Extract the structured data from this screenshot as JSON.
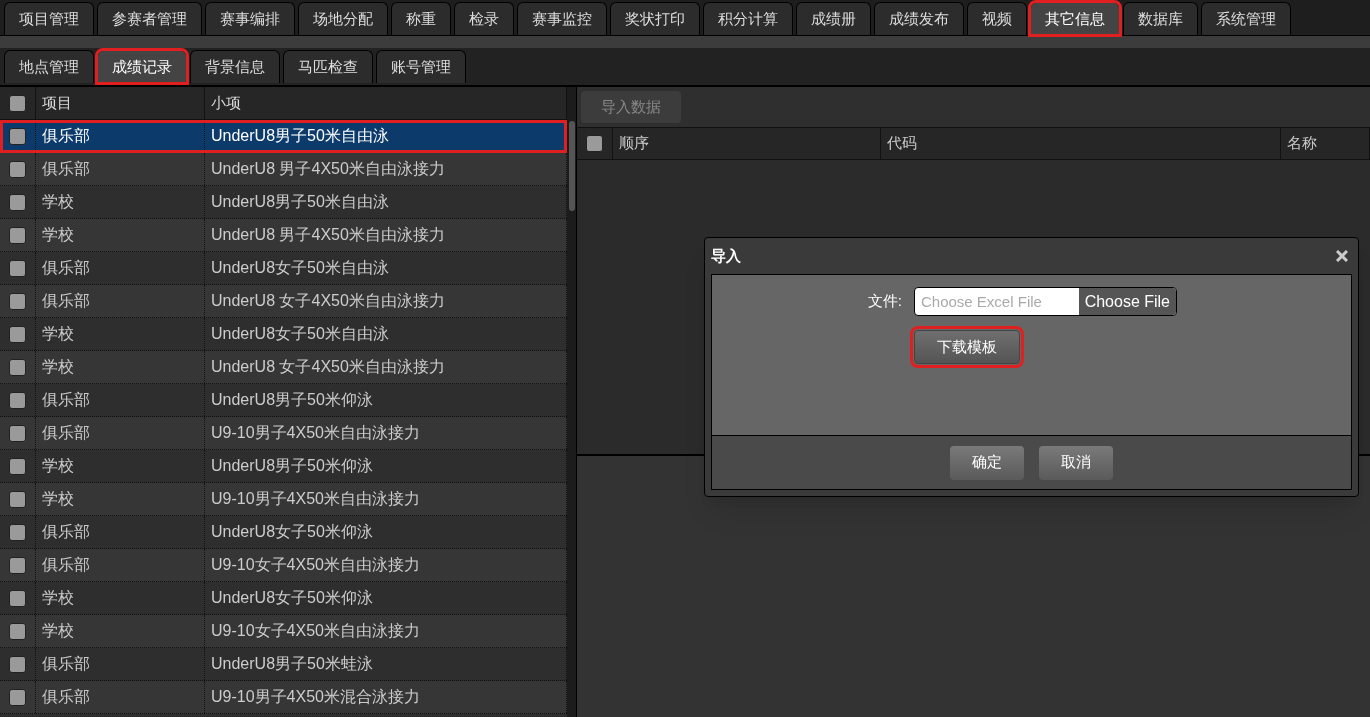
{
  "main_tabs": [
    {
      "label": "项目管理",
      "selected": false,
      "highlighted": false
    },
    {
      "label": "参赛者管理",
      "selected": false,
      "highlighted": false
    },
    {
      "label": "赛事编排",
      "selected": false,
      "highlighted": false
    },
    {
      "label": "场地分配",
      "selected": false,
      "highlighted": false
    },
    {
      "label": "称重",
      "selected": false,
      "highlighted": false
    },
    {
      "label": "检录",
      "selected": false,
      "highlighted": false
    },
    {
      "label": "赛事监控",
      "selected": false,
      "highlighted": false
    },
    {
      "label": "奖状打印",
      "selected": false,
      "highlighted": false
    },
    {
      "label": "积分计算",
      "selected": false,
      "highlighted": false
    },
    {
      "label": "成绩册",
      "selected": false,
      "highlighted": false
    },
    {
      "label": "成绩发布",
      "selected": false,
      "highlighted": false
    },
    {
      "label": "视频",
      "selected": false,
      "highlighted": false
    },
    {
      "label": "其它信息",
      "selected": true,
      "highlighted": true
    },
    {
      "label": "数据库",
      "selected": false,
      "highlighted": false
    },
    {
      "label": "系统管理",
      "selected": false,
      "highlighted": false
    }
  ],
  "sub_tabs": [
    {
      "label": "地点管理",
      "selected": false,
      "highlighted": false
    },
    {
      "label": "成绩记录",
      "selected": true,
      "highlighted": true
    },
    {
      "label": "背景信息",
      "selected": false,
      "highlighted": false
    },
    {
      "label": "马匹检查",
      "selected": false,
      "highlighted": false
    },
    {
      "label": "账号管理",
      "selected": false,
      "highlighted": false
    }
  ],
  "left_table": {
    "header_checked": false,
    "columns": [
      "项目",
      "小项"
    ],
    "rows": [
      {
        "cells": [
          "俱乐部",
          "UnderU8男子50米自由泳"
        ],
        "selected": true,
        "checked": false,
        "highlighted": true
      },
      {
        "cells": [
          "俱乐部",
          "UnderU8 男子4X50米自由泳接力"
        ],
        "selected": false,
        "checked": false,
        "highlighted": false
      },
      {
        "cells": [
          "学校",
          "UnderU8男子50米自由泳"
        ],
        "selected": false,
        "checked": false,
        "highlighted": false
      },
      {
        "cells": [
          "学校",
          "UnderU8 男子4X50米自由泳接力"
        ],
        "selected": false,
        "checked": false,
        "highlighted": false
      },
      {
        "cells": [
          "俱乐部",
          "UnderU8女子50米自由泳"
        ],
        "selected": false,
        "checked": false,
        "highlighted": false
      },
      {
        "cells": [
          "俱乐部",
          "UnderU8 女子4X50米自由泳接力"
        ],
        "selected": false,
        "checked": false,
        "highlighted": false
      },
      {
        "cells": [
          "学校",
          "UnderU8女子50米自由泳"
        ],
        "selected": false,
        "checked": false,
        "highlighted": false
      },
      {
        "cells": [
          "学校",
          "UnderU8 女子4X50米自由泳接力"
        ],
        "selected": false,
        "checked": false,
        "highlighted": false
      },
      {
        "cells": [
          "俱乐部",
          "UnderU8男子50米仰泳"
        ],
        "selected": false,
        "checked": false,
        "highlighted": false
      },
      {
        "cells": [
          "俱乐部",
          "U9-10男子4X50米自由泳接力"
        ],
        "selected": false,
        "checked": false,
        "highlighted": false
      },
      {
        "cells": [
          "学校",
          "UnderU8男子50米仰泳"
        ],
        "selected": false,
        "checked": false,
        "highlighted": false
      },
      {
        "cells": [
          "学校",
          "U9-10男子4X50米自由泳接力"
        ],
        "selected": false,
        "checked": false,
        "highlighted": false
      },
      {
        "cells": [
          "俱乐部",
          "UnderU8女子50米仰泳"
        ],
        "selected": false,
        "checked": false,
        "highlighted": false
      },
      {
        "cells": [
          "俱乐部",
          "U9-10女子4X50米自由泳接力"
        ],
        "selected": false,
        "checked": false,
        "highlighted": false
      },
      {
        "cells": [
          "学校",
          "UnderU8女子50米仰泳"
        ],
        "selected": false,
        "checked": false,
        "highlighted": false
      },
      {
        "cells": [
          "学校",
          "U9-10女子4X50米自由泳接力"
        ],
        "selected": false,
        "checked": false,
        "highlighted": false
      },
      {
        "cells": [
          "俱乐部",
          "UnderU8男子50米蛙泳"
        ],
        "selected": false,
        "checked": false,
        "highlighted": false
      },
      {
        "cells": [
          "俱乐部",
          "U9-10男子4X50米混合泳接力"
        ],
        "selected": false,
        "checked": false,
        "highlighted": false
      }
    ]
  },
  "right_panel": {
    "toolbar_button": {
      "label": "导入数据",
      "disabled": true
    },
    "header_checked": false,
    "columns": [
      "顺序",
      "代码",
      "名称"
    ]
  },
  "dialog": {
    "title": "导入",
    "file_label": "文件:",
    "file_placeholder": "Choose Excel File",
    "choose_button": "Choose File",
    "template_button": {
      "label": "下载模板",
      "highlighted": true
    },
    "buttons": [
      "确定",
      "取消"
    ]
  }
}
